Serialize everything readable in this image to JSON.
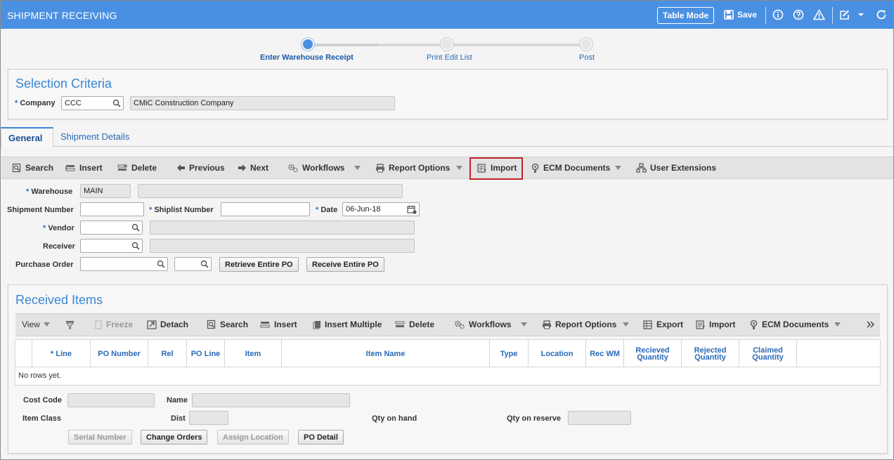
{
  "header": {
    "title": "SHIPMENT RECEIVING",
    "table_mode": "Table Mode",
    "save": "Save"
  },
  "progress": {
    "steps": [
      {
        "label": "Enter Warehouse Receipt",
        "active": true
      },
      {
        "label": "Print Edit List",
        "active": false
      },
      {
        "label": "Post",
        "active": false
      }
    ]
  },
  "selection": {
    "title": "Selection Criteria",
    "company_label": "Company",
    "company_code": "CCC",
    "company_name": "CMiC Construction Company"
  },
  "tabs": [
    {
      "label": "General",
      "active": true
    },
    {
      "label": "Shipment Details",
      "active": false
    }
  ],
  "toolbar": {
    "search": "Search",
    "insert": "Insert",
    "delete": "Delete",
    "previous": "Previous",
    "next": "Next",
    "workflows": "Workflows",
    "report_options": "Report Options",
    "import": "Import",
    "ecm_documents": "ECM Documents",
    "user_extensions": "User Extensions"
  },
  "form": {
    "warehouse_label": "Warehouse",
    "warehouse_value": "MAIN",
    "shipment_number_label": "Shipment Number",
    "shiplist_number_label": "Shiplist Number",
    "date_label": "Date",
    "date_value": "06-Jun-18",
    "vendor_label": "Vendor",
    "receiver_label": "Receiver",
    "purchase_order_label": "Purchase Order",
    "retrieve_po": "Retrieve Entire PO",
    "receive_po": "Receive Entire PO"
  },
  "received": {
    "title": "Received Items",
    "toolbar": {
      "view": "View",
      "freeze": "Freeze",
      "detach": "Detach",
      "search": "Search",
      "insert": "Insert",
      "insert_multiple": "Insert Multiple",
      "delete": "Delete",
      "workflows": "Workflows",
      "report_options": "Report Options",
      "export": "Export",
      "import": "Import",
      "ecm_documents": "ECM Documents"
    },
    "columns": {
      "line": "Line",
      "po_number": "PO Number",
      "rel": "Rel",
      "po_line": "PO Line",
      "item": "Item",
      "item_name": "Item Name",
      "type": "Type",
      "location": "Location",
      "rec_wm": "Rec WM",
      "received_qty_1": "Recieved",
      "received_qty_2": "Quantity",
      "rejected_qty_1": "Rejected",
      "rejected_qty_2": "Quantity",
      "claimed_qty_1": "Claimed",
      "claimed_qty_2": "Quantity"
    },
    "empty": "No rows yet.",
    "detail": {
      "cost_code_label": "Cost Code",
      "name_label": "Name",
      "item_class_label": "Item Class",
      "dist_label": "Dist",
      "qty_on_hand_label": "Qty on hand",
      "qty_on_reserve_label": "Qty on reserve",
      "serial_number": "Serial Number",
      "change_orders": "Change Orders",
      "assign_location": "Assign Location",
      "po_detail": "PO Detail"
    }
  },
  "colors": {
    "header_bg": "#4a90e2",
    "accent": "#3a86d6",
    "highlight_border": "#c0232b"
  }
}
